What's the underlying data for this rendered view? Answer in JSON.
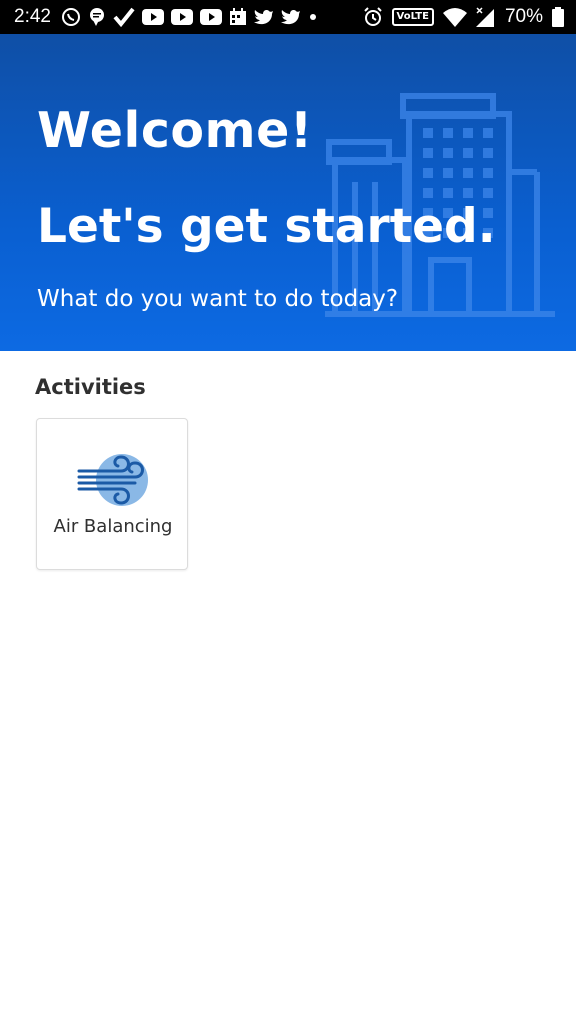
{
  "status_bar": {
    "time": "2:42",
    "battery": "70%",
    "network_badge": "VoLTE",
    "icons_left": [
      "whatsapp-icon",
      "message-icon",
      "check-icon",
      "youtube-icon",
      "youtube-icon",
      "youtube-icon",
      "calendar-icon",
      "twitter-icon",
      "twitter-icon",
      "dot-icon"
    ],
    "icons_right": [
      "alarm-icon",
      "volte-icon",
      "wifi-icon",
      "signal-icon",
      "battery-icon"
    ]
  },
  "hero": {
    "title": "Welcome!",
    "subtitle": "Let's get started.",
    "question": "What do you want to do today?",
    "background_color": "#0a5fd0",
    "decor_icon": "building-icon"
  },
  "activities": {
    "section_title": "Activities",
    "items": [
      {
        "label": "Air Balancing",
        "icon": "air-balancing-icon",
        "icon_color": "#1b5aa6",
        "icon_bg_color": "#8ab8e6"
      }
    ]
  }
}
